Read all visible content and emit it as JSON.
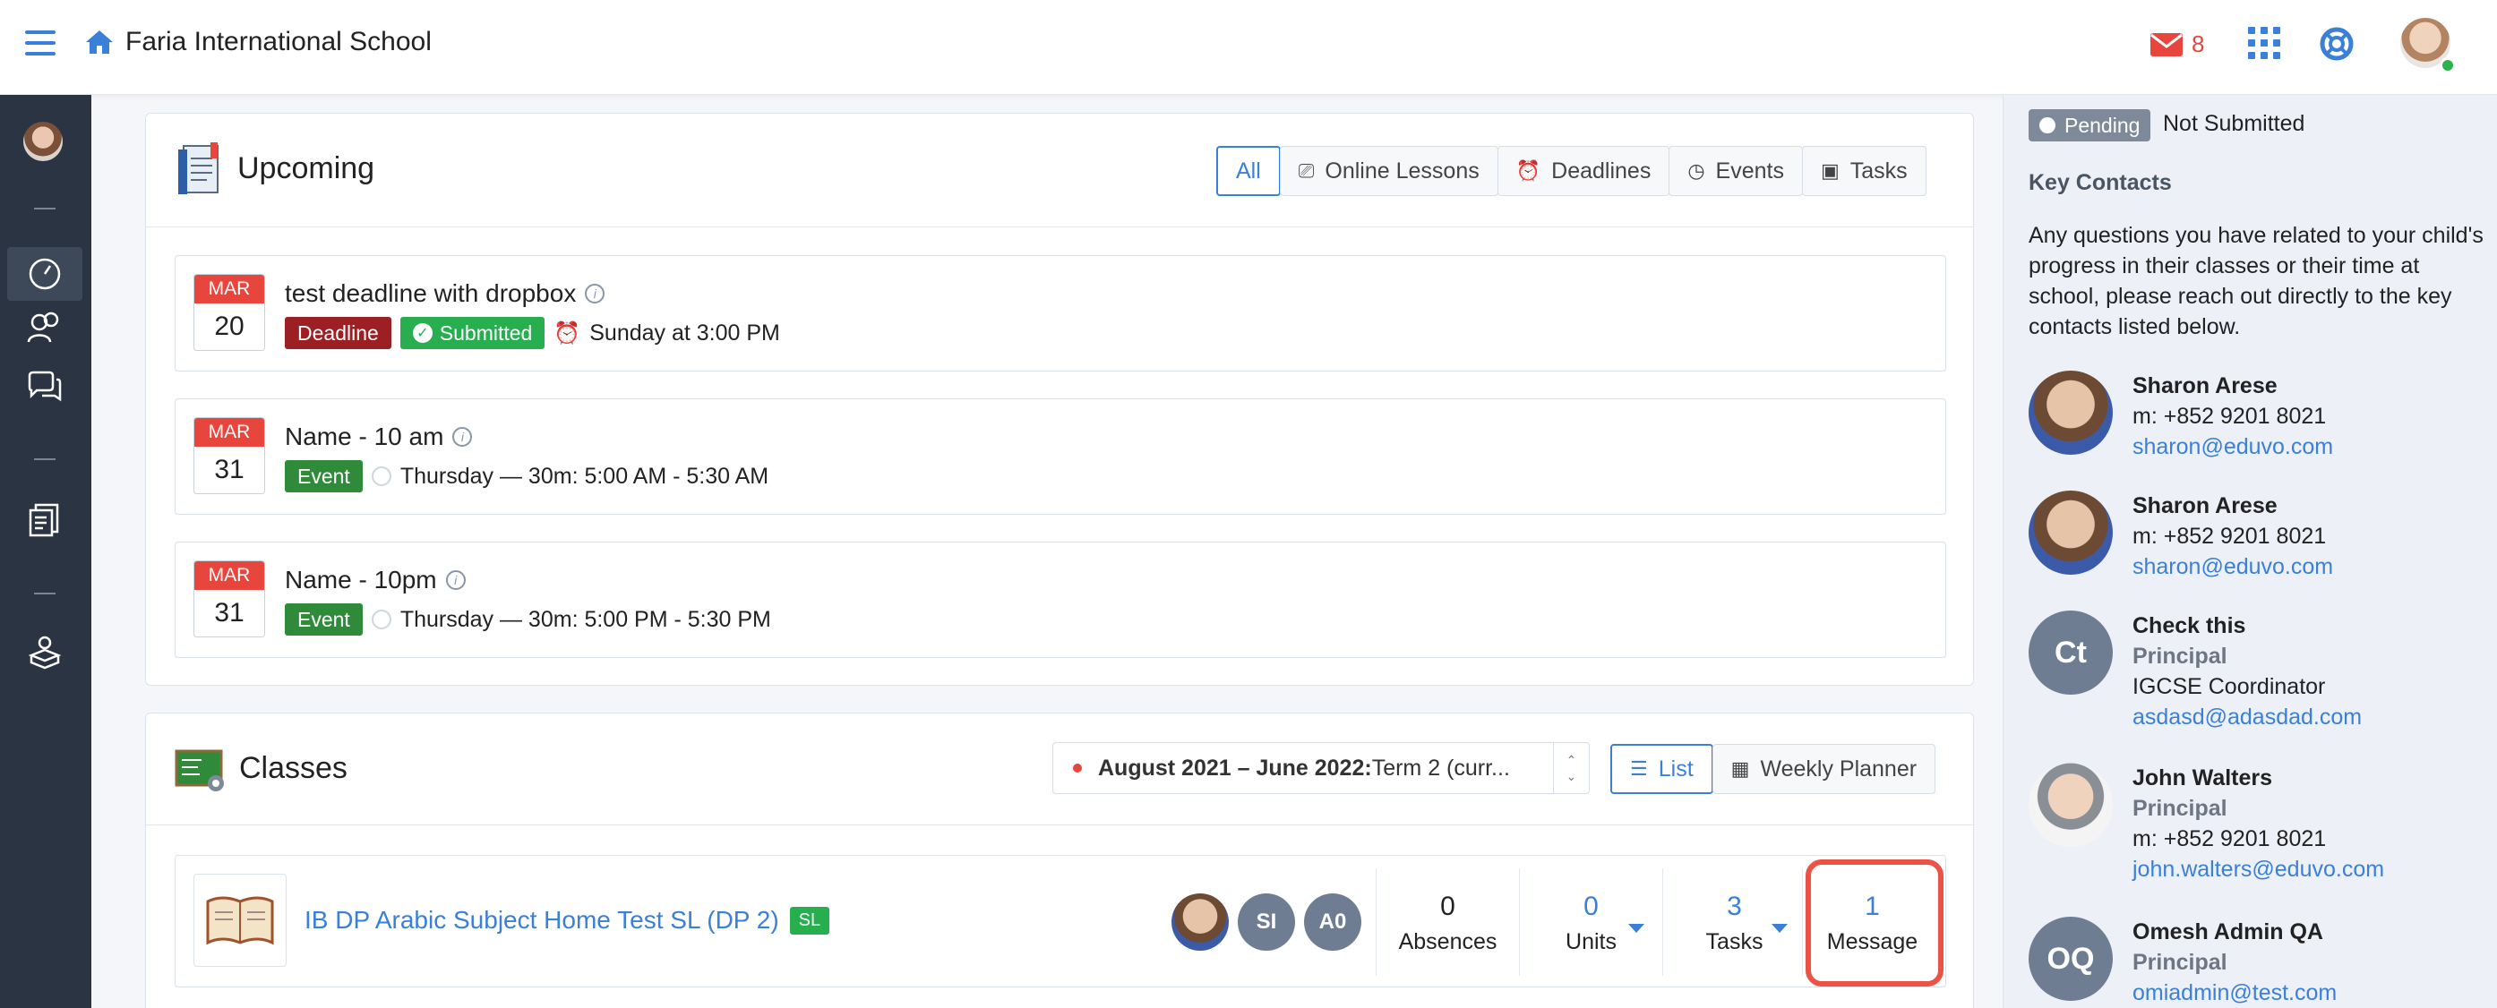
{
  "header": {
    "school_name": "Faria International School",
    "mail_count": "8"
  },
  "upcoming": {
    "title": "Upcoming",
    "filters": [
      "All",
      "Online Lessons",
      "Deadlines",
      "Events",
      "Tasks"
    ],
    "events": [
      {
        "month": "MAR",
        "day": "20",
        "title": "test deadline with dropbox",
        "tags": [
          "Deadline",
          "Submitted"
        ],
        "time": "Sunday at 3:00 PM"
      },
      {
        "month": "MAR",
        "day": "31",
        "title": "Name - 10 am",
        "tags": [
          "Event"
        ],
        "time": "Thursday — 30m: 5:00 AM - 5:30 AM"
      },
      {
        "month": "MAR",
        "day": "31",
        "title": "Name - 10pm",
        "tags": [
          "Event"
        ],
        "time": "Thursday — 30m: 5:00 PM - 5:30 PM"
      }
    ]
  },
  "classes": {
    "title": "Classes",
    "term_bold": "August 2021 – June 2022:",
    "term_rest": " Term 2 (curr...",
    "list_label": "List",
    "weekly_label": "Weekly Planner",
    "row": {
      "name": "IB DP Arabic Subject Home Test SL (DP 2)",
      "level": "SL",
      "avatars": [
        "SI",
        "A0"
      ],
      "absences": {
        "value": "0",
        "label": "Absences"
      },
      "units": {
        "value": "0",
        "label": "Units"
      },
      "tasks": {
        "value": "3",
        "label": "Tasks"
      },
      "message": {
        "value": "1",
        "label": "Message"
      }
    }
  },
  "right_panel": {
    "pending_label": "Pending",
    "not_submitted": "Not Submitted",
    "key_contacts_title": "Key Contacts",
    "key_contacts_desc": "Any questions you have related to your child's progress in their classes or their time at school, please reach out directly to the key contacts listed below.",
    "contacts": [
      {
        "name": "Sharon Arese",
        "line2": "m: +852 9201 8021",
        "email": "sharon@eduvo.com"
      },
      {
        "name": "Sharon Arese",
        "line2": "m: +852 9201 8021",
        "email": "sharon@eduvo.com"
      },
      {
        "name": "Check this",
        "initials": "Ct",
        "role": "Principal",
        "line2": "IGCSE Coordinator",
        "email": "asdasd@adasdad.com"
      },
      {
        "name": "John Walters",
        "role": "Principal",
        "line2": "m: +852 9201 8021",
        "email": "john.walters@eduvo.com"
      },
      {
        "name": "Omesh Admin QA",
        "initials": "OQ",
        "role": "Principal",
        "email": "omiadmin@test.com"
      }
    ]
  },
  "colors": {
    "accent": "#3a7fd8",
    "rail": "#2b3442",
    "deadline": "#9c1f24",
    "success": "#27ae4f",
    "highlight": "#ec5347"
  }
}
